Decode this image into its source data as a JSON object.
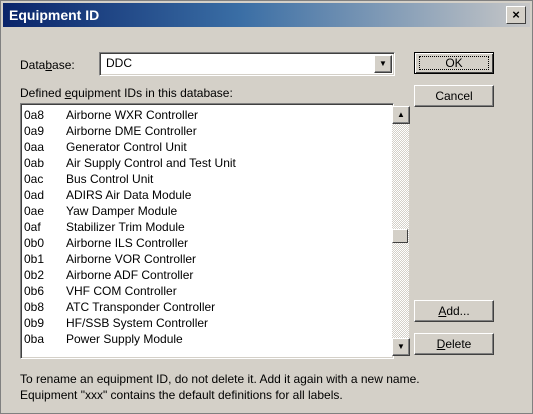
{
  "window": {
    "title": "Equipment ID",
    "close_glyph": "×"
  },
  "database": {
    "label_pre": "Data",
    "label_accel": "b",
    "label_post": "ase:",
    "value": "DDC"
  },
  "list": {
    "label_pre": "Defined ",
    "label_accel": "e",
    "label_post": "quipment IDs in this database:",
    "items": [
      {
        "code": "0a8",
        "name": "Airborne WXR Controller"
      },
      {
        "code": "0a9",
        "name": "Airborne DME Controller"
      },
      {
        "code": "0aa",
        "name": "Generator Control Unit"
      },
      {
        "code": "0ab",
        "name": "Air Supply Control and Test Unit"
      },
      {
        "code": "0ac",
        "name": "Bus Control Unit"
      },
      {
        "code": "0ad",
        "name": "ADIRS Air Data Module"
      },
      {
        "code": "0ae",
        "name": "Yaw Damper Module"
      },
      {
        "code": "0af",
        "name": "Stabilizer Trim Module"
      },
      {
        "code": "0b0",
        "name": "Airborne ILS Controller"
      },
      {
        "code": "0b1",
        "name": "Airborne VOR Controller"
      },
      {
        "code": "0b2",
        "name": "Airborne ADF Controller"
      },
      {
        "code": "0b6",
        "name": "VHF COM Controller"
      },
      {
        "code": "0b8",
        "name": "ATC Transponder Controller"
      },
      {
        "code": "0b9",
        "name": "HF/SSB System Controller"
      },
      {
        "code": "0ba",
        "name": "Power Supply Module"
      }
    ]
  },
  "buttons": {
    "ok": "OK",
    "cancel": "Cancel",
    "add_pre": "",
    "add_accel": "A",
    "add_post": "dd...",
    "delete_pre": "",
    "delete_accel": "D",
    "delete_post": "elete"
  },
  "footer": {
    "line1": "To rename an equipment ID, do not delete it. Add it again with a new name.",
    "line2": "Equipment \"xxx\" contains the default definitions for all labels."
  }
}
